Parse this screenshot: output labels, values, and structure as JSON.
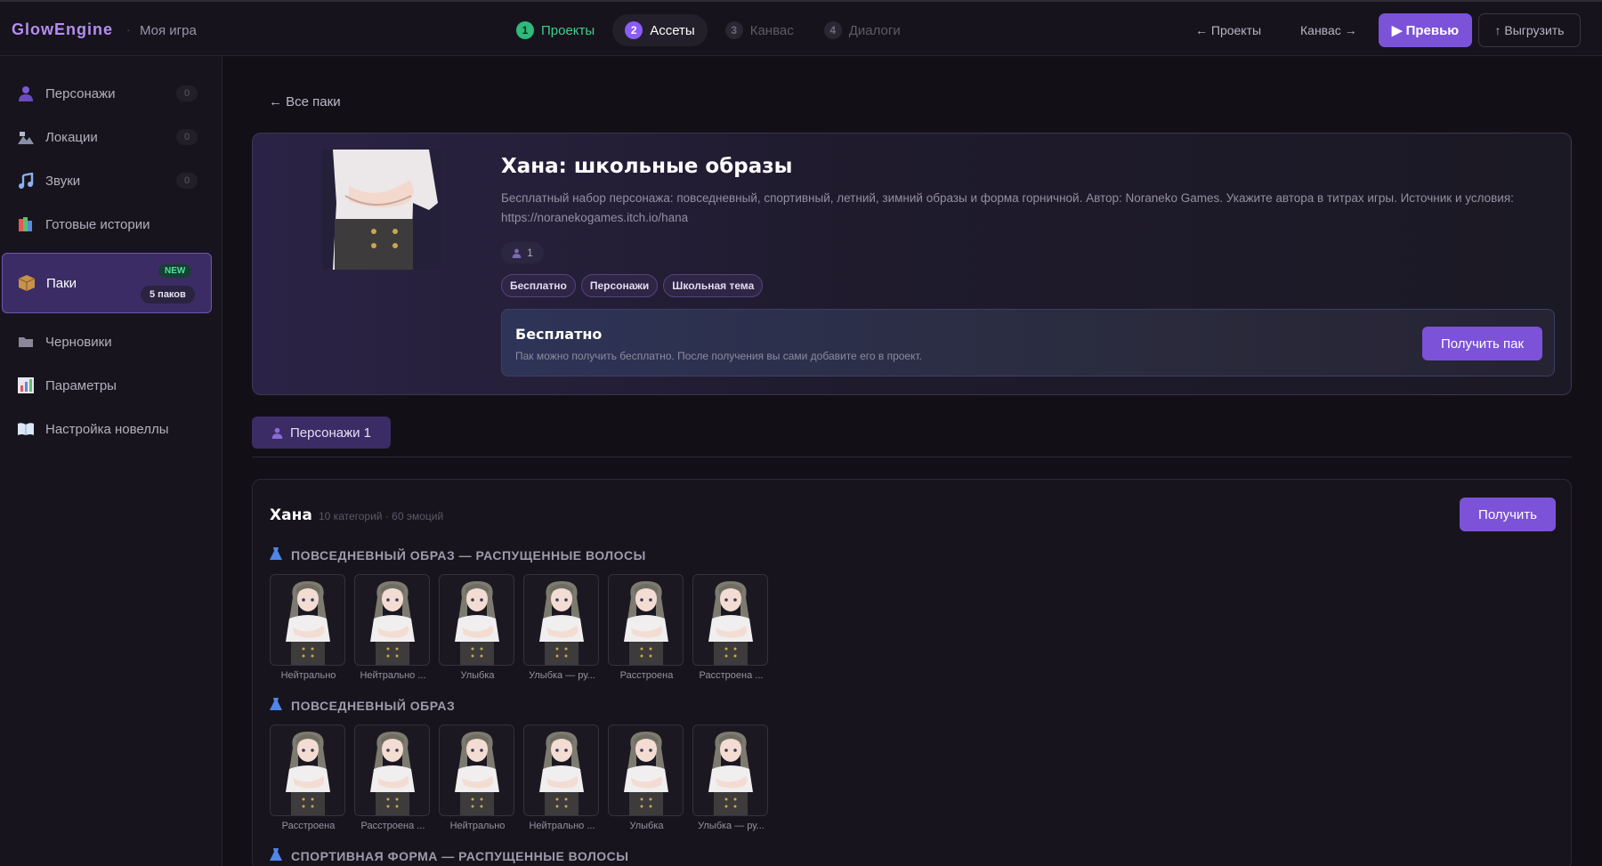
{
  "header": {
    "logo": "GlowEngine",
    "separator": "·",
    "project": "Моя игра",
    "steps": [
      {
        "num": "1",
        "label": "Проекты",
        "state": "done"
      },
      {
        "num": "2",
        "label": "Ассеты",
        "state": "active"
      },
      {
        "num": "3",
        "label": "Канвас",
        "state": "future"
      },
      {
        "num": "4",
        "label": "Диалоги",
        "state": "future"
      }
    ],
    "back_projects": "← Проекты",
    "forward_canvas": "Канвас →",
    "preview": "▶ Превью",
    "export": "↑ Выгрузить"
  },
  "sidebar": {
    "items": [
      {
        "label": "Персонажи",
        "count": "0",
        "icon": "person-icon"
      },
      {
        "label": "Локации",
        "count": "0",
        "icon": "location-icon"
      },
      {
        "label": "Звуки",
        "count": "0",
        "icon": "music-icon"
      },
      {
        "label": "Готовые истории",
        "icon": "books-icon"
      },
      {
        "label": "Паки",
        "icon": "box-icon",
        "badge": "NEW",
        "sub_badge": "5 паков"
      },
      {
        "label": "Черновики",
        "icon": "folder-icon"
      },
      {
        "label": "Параметры",
        "icon": "bar-chart-icon"
      },
      {
        "label": "Настройка новеллы",
        "icon": "book-icon"
      }
    ]
  },
  "main": {
    "back_link": "← Все паки",
    "pack": {
      "title": "Хана: школьные образы",
      "description": "Бесплатный набор персонажа: повседневный, спортивный, летний, зимний образы и форма горничной. Автор: Noraneko Games. Укажите автора в титрах игры. Источник и условия: https://noranekogames.itch.io/hana",
      "characters_count": "1",
      "tags": [
        "Бесплатно",
        "Персонажи",
        "Школьная тема"
      ],
      "free_title": "Бесплатно",
      "free_sub": "Пак можно получить бесплатно. После получения вы сами добавите его в проект.",
      "get_pack": "Получить пак"
    },
    "tab": "Персонажи 1",
    "character": {
      "name": "Хана",
      "meta": "10 категорий · 60 эмоций",
      "get": "Получить",
      "categories": [
        {
          "title": "ПОВСЕДНЕВНЫЙ ОБРАЗ — РАСПУЩЕННЫЕ ВОЛОСЫ",
          "items": [
            "Нейтрально",
            "Нейтрально ...",
            "Улыбка",
            "Улыбка — ру...",
            "Расстроена",
            "Расстроена ..."
          ]
        },
        {
          "title": "ПОВСЕДНЕВНЫЙ ОБРАЗ",
          "items": [
            "Расстроена",
            "Расстроена ...",
            "Нейтрально",
            "Нейтрально ...",
            "Улыбка",
            "Улыбка — ру..."
          ]
        },
        {
          "title": "СПОРТИВНАЯ ФОРМА — РАСПУЩЕННЫЕ ВОЛОСЫ",
          "items": []
        }
      ]
    }
  },
  "colors": {
    "accent": "#7c52d8",
    "done_green": "#3dcf8e",
    "background": "#121016"
  }
}
